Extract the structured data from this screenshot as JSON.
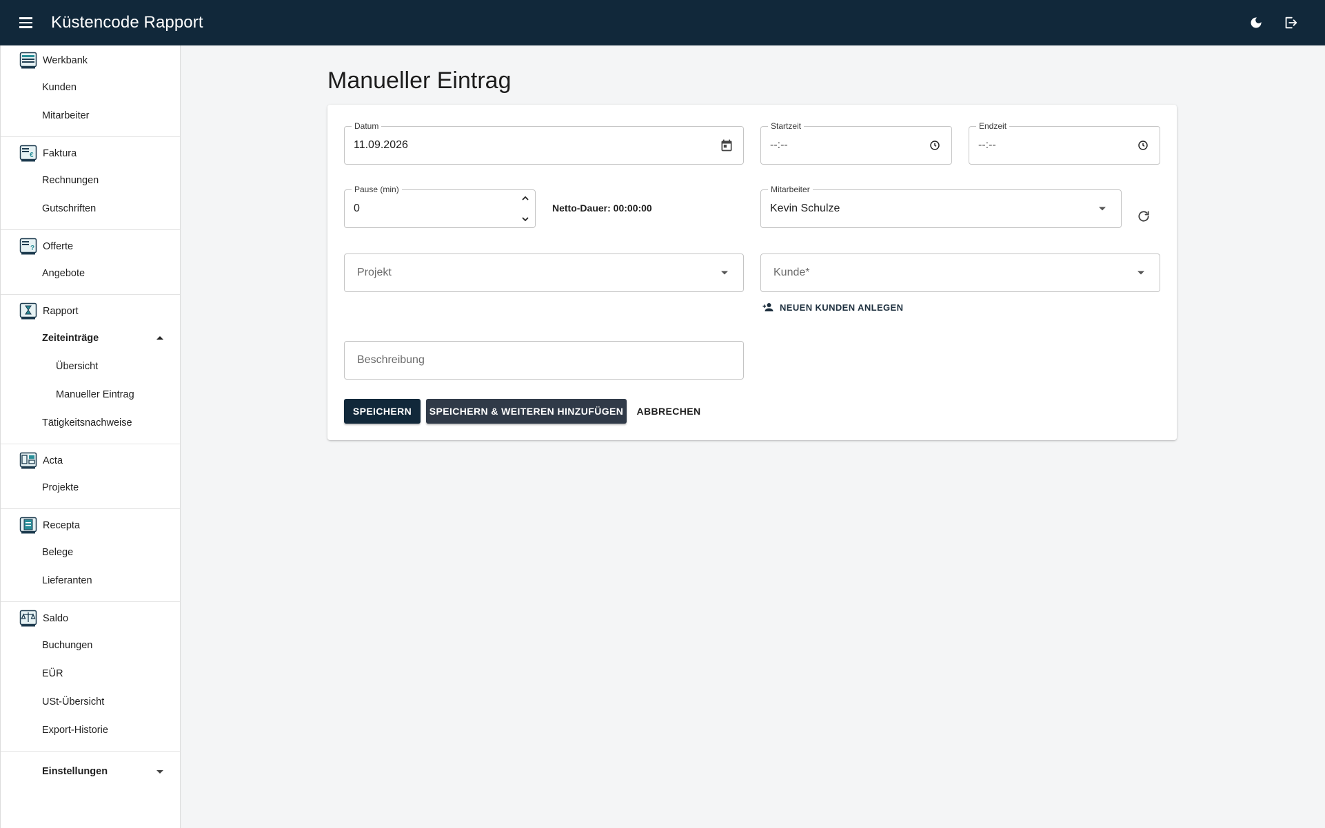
{
  "appbar": {
    "title": "Küstencode Rapport",
    "menu_icon": "hamburger-menu-icon",
    "theme_icon": "moon-icon",
    "logout_icon": "logout-icon"
  },
  "sidebar": {
    "groups": [
      {
        "label": "Werkbank",
        "icon": "workbench-icon",
        "items": [
          "Kunden",
          "Mitarbeiter"
        ]
      },
      {
        "label": "Faktura",
        "icon": "invoice-icon",
        "items": [
          "Rechnungen",
          "Gutschriften"
        ]
      },
      {
        "label": "Offerte",
        "icon": "offer-icon",
        "items": [
          "Angebote"
        ]
      },
      {
        "label": "Rapport",
        "icon": "hourglass-icon",
        "expander": "Zeiteinträge",
        "subitems": [
          "Übersicht",
          "Manueller Eintrag"
        ],
        "items": [
          "Tätigkeitsnachweise"
        ]
      },
      {
        "label": "Acta",
        "icon": "acta-icon",
        "items": [
          "Projekte"
        ]
      },
      {
        "label": "Recepta",
        "icon": "receipt-icon",
        "items": [
          "Belege",
          "Lieferanten"
        ]
      },
      {
        "label": "Saldo",
        "icon": "scale-icon",
        "items": [
          "Buchungen",
          "EÜR",
          "USt-Übersicht",
          "Export-Historie"
        ]
      }
    ],
    "settings": "Einstellungen"
  },
  "main": {
    "title": "Manueller Eintrag",
    "form": {
      "datum": {
        "label": "Datum",
        "value": "11.09.2026"
      },
      "startzeit": {
        "label": "Startzeit",
        "value": "--:--"
      },
      "endzeit": {
        "label": "Endzeit",
        "value": "--:--"
      },
      "pause": {
        "label": "Pause (min)",
        "value": "0"
      },
      "netto": "Netto-Dauer: 00:00:00",
      "mitarbeiter": {
        "label": "Mitarbeiter",
        "value": "Kevin Schulze"
      },
      "projekt": {
        "placeholder": "Projekt"
      },
      "kunde": {
        "placeholder": "Kunde*"
      },
      "add_customer": "NEUEN KUNDEN ANLEGEN",
      "beschreibung": {
        "placeholder": "Beschreibung"
      }
    },
    "buttons": {
      "save": "SPEICHERN",
      "save_add": "SPEICHERN & WEITEREN HINZUFÜGEN",
      "cancel": "ABBRECHEN"
    }
  },
  "colors": {
    "appbar": "#11283a",
    "primary_button": "#11283a",
    "secondary_button": "#303a48",
    "background": "#f4f5f6"
  }
}
